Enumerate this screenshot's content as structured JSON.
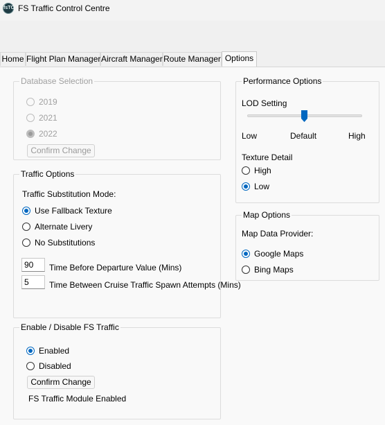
{
  "app": {
    "title": "FS Traffic Control Centre",
    "icon": "app-logo-icon",
    "icon_text": "fsTC"
  },
  "tabs": [
    {
      "label": "Home"
    },
    {
      "label": "Flight Plan Manager"
    },
    {
      "label": "Aircraft Manager"
    },
    {
      "label": "Route Manager"
    },
    {
      "label": "Options",
      "active": true
    }
  ],
  "database": {
    "legend": "Database Selection",
    "options": [
      "2019",
      "2021",
      "2022"
    ],
    "selected": "2022",
    "confirm_label": "Confirm Change"
  },
  "traffic": {
    "legend": "Traffic Options",
    "mode_label": "Traffic Substitution Mode:",
    "options": [
      "Use Fallback Texture",
      "Alternate Livery",
      "No Substitutions"
    ],
    "selected": "Use Fallback Texture",
    "departure_value": "90",
    "departure_label": "Time Before Departure Value (Mins)",
    "spawn_value": "5",
    "spawn_label": "Time Between Cruise Traffic Spawn Attempts (Mins)"
  },
  "enable": {
    "legend": "Enable / Disable FS Traffic",
    "options": [
      "Enabled",
      "Disabled"
    ],
    "selected": "Enabled",
    "confirm_label": "Confirm Change",
    "status": "FS Traffic Module Enabled"
  },
  "performance": {
    "legend": "Performance Options",
    "lod_label": "LOD Setting",
    "lod_ticks": [
      "Low",
      "Default",
      "High"
    ],
    "lod_level": 0.5,
    "texture_label": "Texture Detail",
    "texture_options": [
      "High",
      "Low"
    ],
    "texture_selected": "Low"
  },
  "map": {
    "legend": "Map Options",
    "provider_label": "Map Data Provider:",
    "options": [
      "Google Maps",
      "Bing Maps"
    ],
    "selected": "Google Maps"
  },
  "colors": {
    "accent": "#0067c0",
    "disabled_text": "#a0a0a0"
  }
}
